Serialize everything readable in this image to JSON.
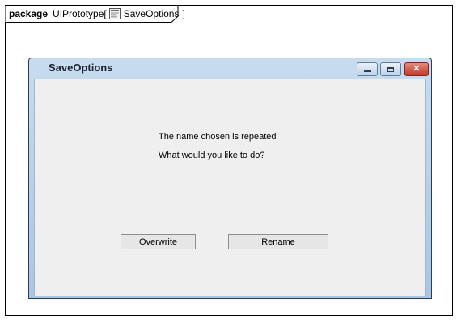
{
  "frame": {
    "keyword": "package",
    "name": "UIPrototype",
    "open_bracket": "[",
    "element_name": "SaveOptions",
    "close_bracket": "]",
    "element_icon": "frame-diagram-icon"
  },
  "window": {
    "title": "SaveOptions",
    "controls": {
      "minimize_icon": "minimize-icon",
      "maximize_icon": "maximize-icon",
      "close_icon": "close-icon"
    }
  },
  "content": {
    "message_line1": "The name chosen is repeated",
    "message_line2": "What would you like to do?",
    "overwrite_label": "Overwrite",
    "rename_label": "Rename"
  },
  "colors": {
    "title_bar": "#a9c6e3",
    "client_bg": "#efefef",
    "close_button": "#c2392a"
  }
}
